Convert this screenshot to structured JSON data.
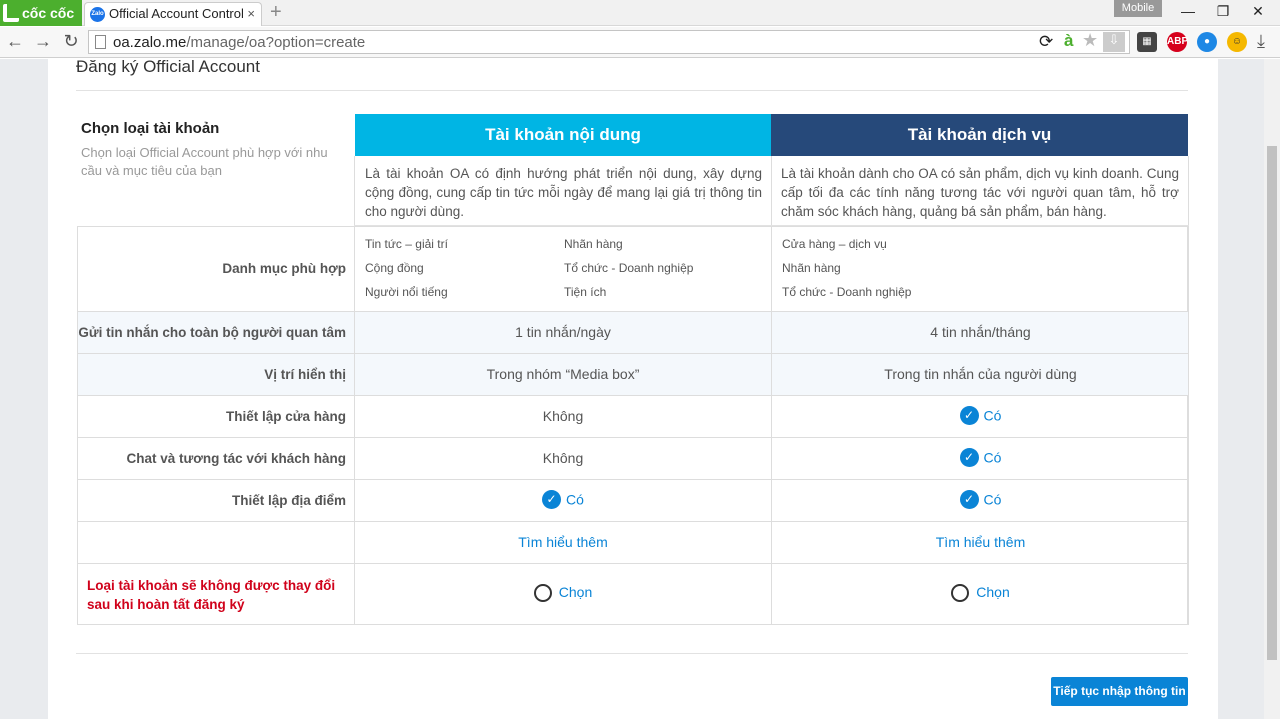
{
  "browser": {
    "brand": "cốc cốc",
    "tab_title": "Official Account Control",
    "tab_favicon": "Zalo",
    "tab_close": "×",
    "new_tab": "+",
    "mobile_label": "Mobile",
    "url_host": "oa.zalo.me",
    "url_path": "/manage/oa?option=create",
    "extensions": [
      "ABP"
    ]
  },
  "page": {
    "title": "Đăng ký Official Account",
    "side_title": "Chọn loại tài khoản",
    "side_desc": "Chọn loại Official Account phù hợp với nhu cầu và mục tiêu của bạn",
    "warning": "Loại tài khoản sẽ không được thay đổi sau khi hoàn tất đăng ký",
    "continue_button": "Tiếp tục nhập thông tin"
  },
  "columns": [
    {
      "title": "Tài khoản nội dung",
      "color": "#00b5e4",
      "description": "Là tài khoản OA có định hướng phát triển nội dung, xây dựng cộng đồng, cung cấp tin tức mỗi ngày để mang lại giá trị thông tin cho người dùng.",
      "categories": [
        "Tin tức – giải trí",
        "Nhãn hàng",
        "Cộng đồng",
        "Tổ chức - Doanh nghiệp",
        "Người nổi tiếng",
        "Tiện ích"
      ],
      "broadcast": "1 tin nhắn/ngày",
      "position": "Trong nhóm “Media box”",
      "store": "Không",
      "chat": "Không",
      "location": "Có",
      "learn_more": "Tìm hiểu thêm",
      "choose": "Chọn"
    },
    {
      "title": "Tài khoản dịch vụ",
      "color": "#26497a",
      "description": "Là tài khoản dành cho OA có sản phẩm, dịch vụ kinh doanh. Cung cấp tối đa các tính năng tương tác với người quan tâm, hỗ trợ chăm sóc khách hàng, quảng bá sản phẩm, bán hàng.",
      "categories": [
        "Cửa hàng – dịch vụ",
        "Nhãn hàng",
        "Tổ chức - Doanh nghiệp"
      ],
      "broadcast": "4 tin nhắn/tháng",
      "position": "Trong tin nhắn của người dùng",
      "store": "Có",
      "chat": "Có",
      "location": "Có",
      "learn_more": "Tìm hiểu thêm",
      "choose": "Chọn"
    }
  ],
  "rows": {
    "categories": "Danh mục phù hợp",
    "broadcast": "Gửi tin nhắn cho toàn bộ người quan tâm",
    "position": "Vị trí hiển thị",
    "store": "Thiết lập cửa hàng",
    "chat": "Chat và tương tác với khách hàng",
    "location": "Thiết lập địa điểm"
  },
  "colors": {
    "accent": "#0a84d6",
    "warning": "#d0021b"
  }
}
